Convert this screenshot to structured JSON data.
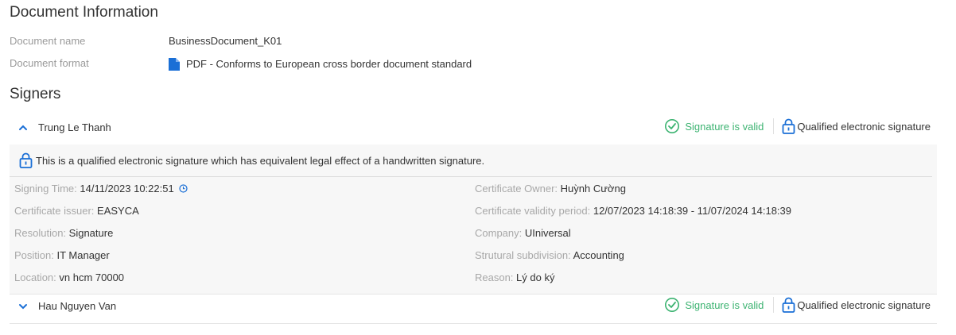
{
  "document": {
    "title": "Document Information",
    "name_label": "Document name",
    "name_value": "BusinessDocument_K01",
    "format_label": "Document format",
    "format_value": "PDF - Conforms to European cross border document standard",
    "format_icon": "file-icon"
  },
  "signers_title": "Signers",
  "colors": {
    "accent": "#1a6fd6",
    "valid": "#3cb371"
  },
  "signers": [
    {
      "name": "Trung Le Thanh",
      "expanded": true,
      "status": "Signature is valid",
      "type": "Qualified electronic signature",
      "notice": "This is a qualified electronic signature which has equivalent legal effect of a handwritten signature.",
      "left_fields": [
        {
          "key": "Signing Time: ",
          "value": "14/11/2023 10:22:51"
        },
        {
          "key": "Certificate issuer: ",
          "value": "EASYCA"
        },
        {
          "key": "Resolution: ",
          "value": "Signature"
        },
        {
          "key": "Position: ",
          "value": "IT Manager"
        },
        {
          "key": "Location: ",
          "value": "vn hcm 70000"
        }
      ],
      "right_fields": [
        {
          "key": "Certificate Owner: ",
          "value": "Huỳnh Cường"
        },
        {
          "key": "Certificate validity period: ",
          "value": "12/07/2023 14:18:39 - 11/07/2024 14:18:39"
        },
        {
          "key": "Company: ",
          "value": "UIniversal"
        },
        {
          "key": "Strutural subdivision: ",
          "value": "Accounting"
        },
        {
          "key": "Reason: ",
          "value": "Lý do ký"
        }
      ]
    },
    {
      "name": "Hau Nguyen Van",
      "expanded": false,
      "status": "Signature is valid",
      "type": "Qualified electronic signature"
    }
  ]
}
